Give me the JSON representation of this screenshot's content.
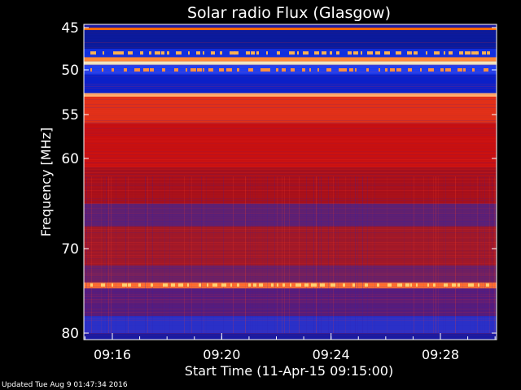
{
  "chart_data": {
    "type": "heatmap",
    "title": "Solar radio Flux (Glasgow)",
    "xlabel": "Start Time (11-Apr-15 09:15:00)",
    "ylabel": "Frequency [MHz]",
    "x_unit": "time (HH:MM)",
    "y_unit": "MHz",
    "xlim": [
      "09:15:00",
      "09:30:30"
    ],
    "ylim": [
      80,
      45
    ],
    "x_ticks": [
      "09:16",
      "09:20",
      "09:24",
      "09:28"
    ],
    "y_ticks": [
      45,
      50,
      55,
      60,
      70,
      80
    ],
    "colormap": "blue-red-yellow (low to high intensity)",
    "grid": false,
    "bands": [
      {
        "f_from": 45.0,
        "f_to": 45.3,
        "level": "high",
        "color": "#ff6a00"
      },
      {
        "f_from": 45.3,
        "f_to": 47.5,
        "level": "low",
        "color": "#0a1a9a"
      },
      {
        "f_from": 47.5,
        "f_to": 48.5,
        "level": "mid",
        "color": "#1030e0"
      },
      {
        "f_from": 48.5,
        "f_to": 49.0,
        "level": "high",
        "color": "#ff8a3a"
      },
      {
        "f_from": 49.0,
        "f_to": 49.4,
        "level": "max",
        "color": "#fff0c0"
      },
      {
        "f_from": 49.4,
        "f_to": 50.5,
        "level": "mid",
        "color": "#2040f0"
      },
      {
        "f_from": 50.5,
        "f_to": 52.6,
        "level": "low",
        "color": "#0a20c8"
      },
      {
        "f_from": 52.6,
        "f_to": 53.0,
        "level": "high",
        "color": "#ffb070"
      },
      {
        "f_from": 53.0,
        "f_to": 56.0,
        "level": "high",
        "color": "#e03018"
      },
      {
        "f_from": 56.0,
        "f_to": 61.0,
        "level": "high",
        "color": "#c81010"
      },
      {
        "f_from": 61.0,
        "f_to": 65.0,
        "level": "mid-high",
        "color": "#a8101a"
      },
      {
        "f_from": 65.0,
        "f_to": 67.5,
        "level": "mid",
        "color": "#602070"
      },
      {
        "f_from": 67.5,
        "f_to": 72.0,
        "level": "mid-high",
        "color": "#a01828"
      },
      {
        "f_from": 72.0,
        "f_to": 74.0,
        "level": "mid",
        "color": "#702060"
      },
      {
        "f_from": 74.0,
        "f_to": 74.7,
        "level": "high",
        "color": "#ff7030"
      },
      {
        "f_from": 74.7,
        "f_to": 78.0,
        "level": "mid",
        "color": "#581c7a"
      },
      {
        "f_from": 78.0,
        "f_to": 80.0,
        "level": "low",
        "color": "#2a30c8"
      }
    ]
  },
  "footer": {
    "updated": "Updated Tue Aug  9 01:47:34 2016"
  }
}
